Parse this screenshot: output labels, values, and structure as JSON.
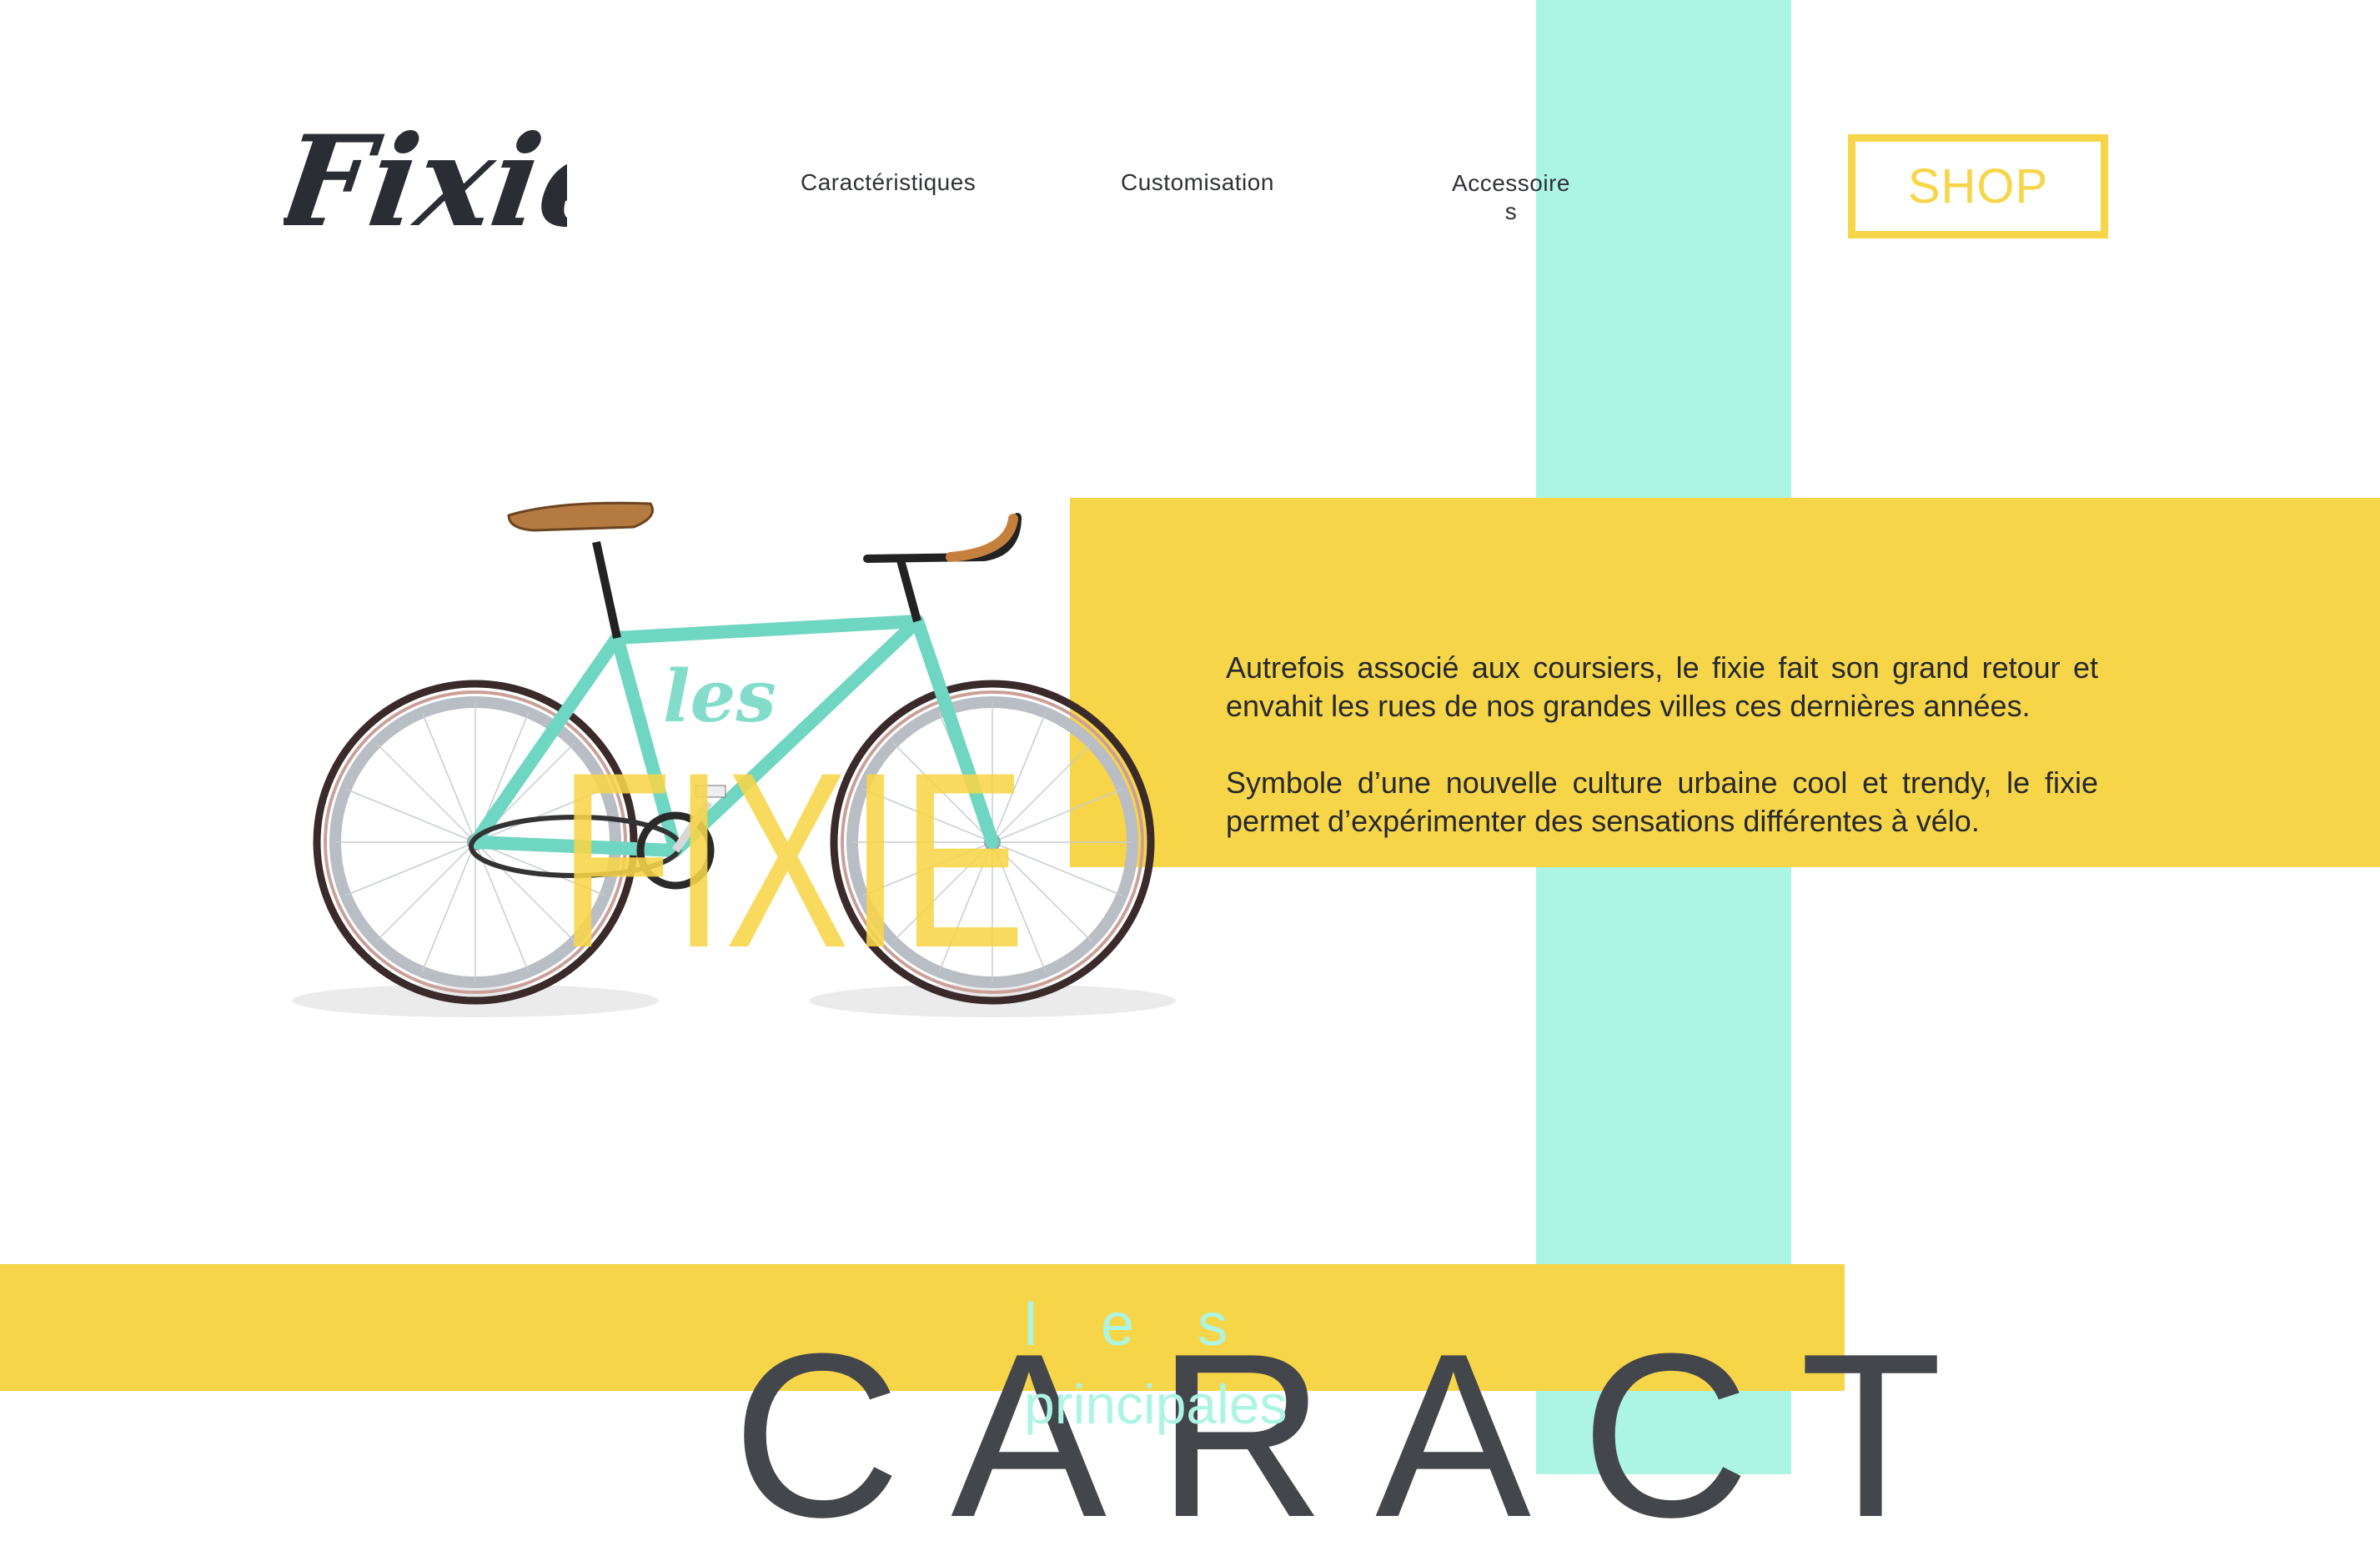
{
  "theme": {
    "yellow": "#F7D548",
    "mint": "#ACF5E4",
    "dark": "#2A2D33",
    "heading_gray": "#43474C"
  },
  "header": {
    "logo_text": "Fixie",
    "nav": {
      "caracteristiques": "Caractéristiques",
      "customisation": "Customisation",
      "accessoires": "Accessoires"
    },
    "shop_label": "SHOP"
  },
  "hero": {
    "image": "fixie-bike-mint",
    "overlay_small": "les",
    "overlay_big": "FIXIE",
    "paragraphs": [
      "Autrefois associé aux coursiers, le fixie fait son grand retour et envahit les rues de nos grandes villes ces dernières années.",
      "Symbole d’une nouvelle culture urbaine cool et trendy, le fixie permet d’expérimenter des sensations différentes à vélo."
    ]
  },
  "section": {
    "les": "les",
    "principales": "principales",
    "heading": "CARACT"
  }
}
